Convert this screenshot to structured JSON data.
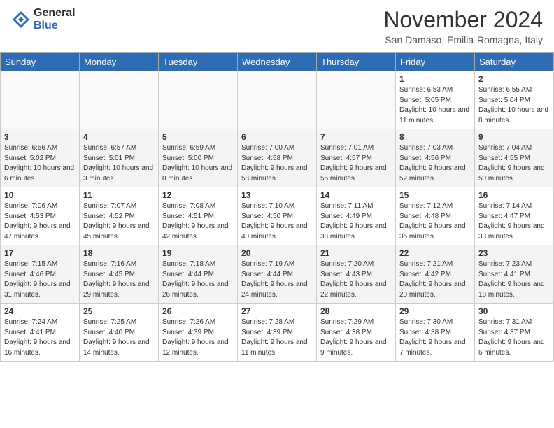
{
  "header": {
    "logo_general": "General",
    "logo_blue": "Blue",
    "title": "November 2024",
    "location": "San Damaso, Emilia-Romagna, Italy"
  },
  "weekdays": [
    "Sunday",
    "Monday",
    "Tuesday",
    "Wednesday",
    "Thursday",
    "Friday",
    "Saturday"
  ],
  "weeks": [
    [
      {
        "day": "",
        "info": ""
      },
      {
        "day": "",
        "info": ""
      },
      {
        "day": "",
        "info": ""
      },
      {
        "day": "",
        "info": ""
      },
      {
        "day": "",
        "info": ""
      },
      {
        "day": "1",
        "info": "Sunrise: 6:53 AM\nSunset: 5:05 PM\nDaylight: 10 hours and 11 minutes."
      },
      {
        "day": "2",
        "info": "Sunrise: 6:55 AM\nSunset: 5:04 PM\nDaylight: 10 hours and 8 minutes."
      }
    ],
    [
      {
        "day": "3",
        "info": "Sunrise: 6:56 AM\nSunset: 5:02 PM\nDaylight: 10 hours and 6 minutes."
      },
      {
        "day": "4",
        "info": "Sunrise: 6:57 AM\nSunset: 5:01 PM\nDaylight: 10 hours and 3 minutes."
      },
      {
        "day": "5",
        "info": "Sunrise: 6:59 AM\nSunset: 5:00 PM\nDaylight: 10 hours and 0 minutes."
      },
      {
        "day": "6",
        "info": "Sunrise: 7:00 AM\nSunset: 4:58 PM\nDaylight: 9 hours and 58 minutes."
      },
      {
        "day": "7",
        "info": "Sunrise: 7:01 AM\nSunset: 4:57 PM\nDaylight: 9 hours and 55 minutes."
      },
      {
        "day": "8",
        "info": "Sunrise: 7:03 AM\nSunset: 4:56 PM\nDaylight: 9 hours and 52 minutes."
      },
      {
        "day": "9",
        "info": "Sunrise: 7:04 AM\nSunset: 4:55 PM\nDaylight: 9 hours and 50 minutes."
      }
    ],
    [
      {
        "day": "10",
        "info": "Sunrise: 7:06 AM\nSunset: 4:53 PM\nDaylight: 9 hours and 47 minutes."
      },
      {
        "day": "11",
        "info": "Sunrise: 7:07 AM\nSunset: 4:52 PM\nDaylight: 9 hours and 45 minutes."
      },
      {
        "day": "12",
        "info": "Sunrise: 7:08 AM\nSunset: 4:51 PM\nDaylight: 9 hours and 42 minutes."
      },
      {
        "day": "13",
        "info": "Sunrise: 7:10 AM\nSunset: 4:50 PM\nDaylight: 9 hours and 40 minutes."
      },
      {
        "day": "14",
        "info": "Sunrise: 7:11 AM\nSunset: 4:49 PM\nDaylight: 9 hours and 38 minutes."
      },
      {
        "day": "15",
        "info": "Sunrise: 7:12 AM\nSunset: 4:48 PM\nDaylight: 9 hours and 35 minutes."
      },
      {
        "day": "16",
        "info": "Sunrise: 7:14 AM\nSunset: 4:47 PM\nDaylight: 9 hours and 33 minutes."
      }
    ],
    [
      {
        "day": "17",
        "info": "Sunrise: 7:15 AM\nSunset: 4:46 PM\nDaylight: 9 hours and 31 minutes."
      },
      {
        "day": "18",
        "info": "Sunrise: 7:16 AM\nSunset: 4:45 PM\nDaylight: 9 hours and 29 minutes."
      },
      {
        "day": "19",
        "info": "Sunrise: 7:18 AM\nSunset: 4:44 PM\nDaylight: 9 hours and 26 minutes."
      },
      {
        "day": "20",
        "info": "Sunrise: 7:19 AM\nSunset: 4:44 PM\nDaylight: 9 hours and 24 minutes."
      },
      {
        "day": "21",
        "info": "Sunrise: 7:20 AM\nSunset: 4:43 PM\nDaylight: 9 hours and 22 minutes."
      },
      {
        "day": "22",
        "info": "Sunrise: 7:21 AM\nSunset: 4:42 PM\nDaylight: 9 hours and 20 minutes."
      },
      {
        "day": "23",
        "info": "Sunrise: 7:23 AM\nSunset: 4:41 PM\nDaylight: 9 hours and 18 minutes."
      }
    ],
    [
      {
        "day": "24",
        "info": "Sunrise: 7:24 AM\nSunset: 4:41 PM\nDaylight: 9 hours and 16 minutes."
      },
      {
        "day": "25",
        "info": "Sunrise: 7:25 AM\nSunset: 4:40 PM\nDaylight: 9 hours and 14 minutes."
      },
      {
        "day": "26",
        "info": "Sunrise: 7:26 AM\nSunset: 4:39 PM\nDaylight: 9 hours and 12 minutes."
      },
      {
        "day": "27",
        "info": "Sunrise: 7:28 AM\nSunset: 4:39 PM\nDaylight: 9 hours and 11 minutes."
      },
      {
        "day": "28",
        "info": "Sunrise: 7:29 AM\nSunset: 4:38 PM\nDaylight: 9 hours and 9 minutes."
      },
      {
        "day": "29",
        "info": "Sunrise: 7:30 AM\nSunset: 4:38 PM\nDaylight: 9 hours and 7 minutes."
      },
      {
        "day": "30",
        "info": "Sunrise: 7:31 AM\nSunset: 4:37 PM\nDaylight: 9 hours and 6 minutes."
      }
    ]
  ]
}
